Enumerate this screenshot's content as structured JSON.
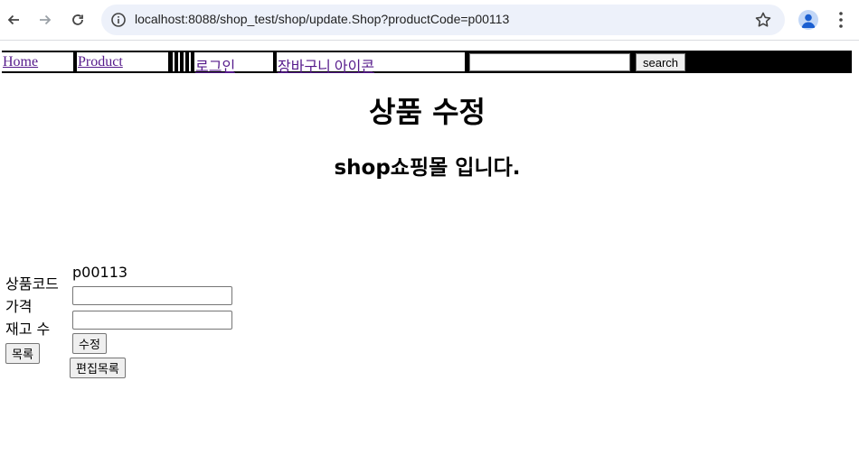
{
  "browser": {
    "url": "localhost:8088/shop_test/shop/update.Shop?productCode=p00113"
  },
  "nav": {
    "home": "Home",
    "product": "Product",
    "login": "로그인",
    "cart": "장바구니 아이콘",
    "search_placeholder": "",
    "search_label": "search"
  },
  "page": {
    "title": "상품 수정",
    "subtitle": "shop쇼핑몰 입니다."
  },
  "form": {
    "code_label": "상품코드",
    "code_value": "p00113",
    "price_label": "가격",
    "price_value": "",
    "stock_label": "재고 수",
    "stock_value": "",
    "list_button": "목록",
    "update_button": "수정",
    "edit_list_button": "편집목록"
  },
  "colors": {
    "link_visited": "#551a8b",
    "omnibox_bg": "#edf1fa",
    "nav_bar": "#000000"
  }
}
